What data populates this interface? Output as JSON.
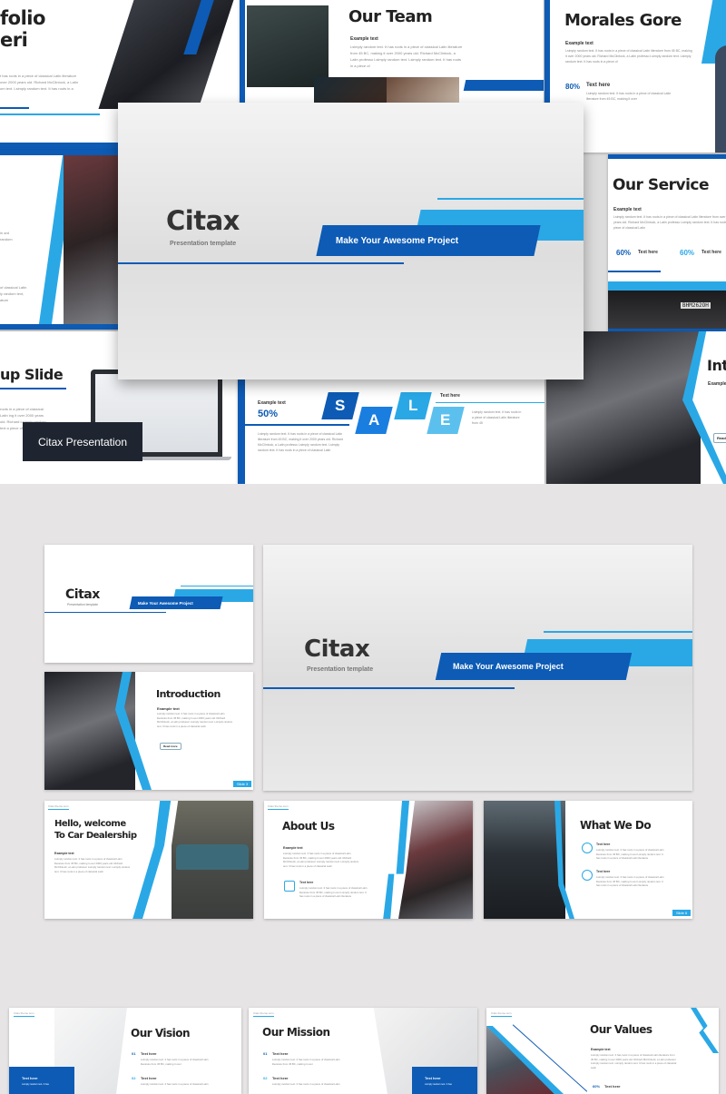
{
  "collage": {
    "portfolio": {
      "title_line1": "folio",
      "title_line2": "eri",
      "body": "t has roots in a piece of classical Latin literature over 2000 years old. Richard McClintock, a Latin om text. Lsimply random text. It has roots in a"
    },
    "team": {
      "title": "Our Team",
      "subtitle": "Example text",
      "body": "Lsimply random text. It has roots in a piece of classical Latin literature from 45 BC, making it over 2000 years old. Richard McClintock, a Latin professo Lsimply random text. Lsimply random text. It has roots in a piece of"
    },
    "morales": {
      "title": "Morales Gore",
      "subtitle": "Example text",
      "body": "Lsimply random text. It has roots in a piece of classical Latin literature from 45 BC, making it over 2000 years old. Richard McClintock, a Latin professo Lsimply random text. Lsimply random text. It has roots in a piece of",
      "stat_value": "80%",
      "stat_label": "Text here",
      "stat_body": "Lsimply random text. It has roots in a piece of classical Latin literature from 45 BC, making it over"
    },
    "service": {
      "title": "Our Service",
      "subtitle": "Example text",
      "body": "Lsimply random text. It has roots in a piece of classical Latin literature from over 2000 years old. Richard McClintock, a Latin professo Lsimply random text. It has roots in a piece of classical Latin",
      "stats": [
        {
          "value": "60%",
          "label": "Text here"
        },
        {
          "value": "60%",
          "label": "Text here"
        }
      ],
      "plate": "BHM262OH"
    },
    "left_mid": {
      "body1": "in ard random",
      "body2": "of classical Latin ly random text, ature"
    },
    "mockup": {
      "title": "up Slide",
      "body": "roots in a piece of classical Latin ing it over 2000 years old. Richard Lsimply random text a piece of classical Latin",
      "caption": "Citax Presentation"
    },
    "sale": {
      "label": "Example text",
      "value": "50%",
      "letters": [
        "S",
        "A",
        "L",
        "E"
      ],
      "text_here": "Text here",
      "body_left": "Lsimply random text. It has roots in a piece of classical Latin literature from 45 BC, making it over 2000 years old. Richard McClintock, a Latin professo Lsimply random text. Lsimply random text. It has roots in a piece of classical Latin",
      "body_right": "Lsimply random text. It has roots in a piece of classical Latin literature from 45"
    },
    "intro_partial": {
      "title": "Int",
      "subtitle": "Example",
      "button": "Read m"
    },
    "hero": {
      "title": "Citax",
      "subtitle": "Presentation template",
      "banner": "Make Your Awesome Project"
    }
  },
  "grid": {
    "cover_small": {
      "title": "Citax",
      "subtitle": "Presentation template",
      "banner": "Make Your Awesome Project"
    },
    "cover_large": {
      "title": "Citax",
      "subtitle": "Presentation template",
      "banner": "Make Your Awesome Project"
    },
    "introduction": {
      "title": "Introduction",
      "subtitle": "Example text",
      "body": "Lsimply random text. It has roots in a piece of classical Latin literature from 45 BC, making it over 2000 years old. Richard McClintock, a Latin professor Lsimply random text. Lsimply random text. It has roots in a piece of classical Latin",
      "button": "Read more",
      "badge": "Slide 3"
    },
    "welcome": {
      "url": "Citax theme.com",
      "title_line1": "Hello, welcome",
      "title_line2": "To Car Dealership",
      "subtitle": "Example text",
      "body": "Lsimply random text. It has roots in a piece of classical Latin literature from 45 BC, making it over 2000 years old. Richard McClintock, a Latin professor Lsimply random text. Lsimply random text. It has roots in a piece of classical Latin"
    },
    "about": {
      "url": "Citax theme.com",
      "title": "About Us",
      "subtitle": "Example text",
      "body": "Lsimply random text. It has roots in a piece of classical Latin literature from 45 BC, making it over 2000 years old. Richard McClintock, a Latin professor Lsimply random text. Lsimply random text. It has roots in a piece of classical Latin",
      "item_title": "Text here",
      "item_body": "Lsimply random text. It has roots in a piece of classical Latin literature from 45 BC, making it over Lsimply random text. It has roots in a piece of classical Latin literature"
    },
    "what_we_do": {
      "title": "What We Do",
      "items": [
        {
          "title": "Text here",
          "body": "Lsimply random text. It has roots in a piece of classical Latin literature from 45 BC, making it over Lsimply random text. It has roots in a piece of classical Latin literature"
        },
        {
          "title": "Text here",
          "body": "Lsimply random text. It has roots in a piece of classical Latin literature from 45 BC, making it over Lsimply random text. It has roots in a piece of classical Latin literature"
        }
      ],
      "badge": "Slide 6"
    },
    "vision": {
      "url": "Citax theme.com",
      "title": "Our Vision",
      "items": [
        {
          "num": "01",
          "title": "Text here",
          "body": "Lsimply random text. It has roots in a piece of classical Latin literature from 45 BC, making it over"
        },
        {
          "num": "02",
          "title": "Text here",
          "body": "Lsimply random text. It has roots in a piece of classical Latin"
        }
      ],
      "card_title": "Text here",
      "card_body": "Lsimply random text. It has"
    },
    "mission": {
      "url": "Citax theme.com",
      "title": "Our Mission",
      "items": [
        {
          "num": "01",
          "title": "Text here",
          "body": "Lsimply random text. It has roots in a piece of classical Latin literature from 45 BC, making it over"
        },
        {
          "num": "02",
          "title": "Text here",
          "body": "Lsimply random text. It has roots in a piece of classical Latin"
        }
      ],
      "card_title": "Text here",
      "card_body": "Lsimply random text. It has"
    },
    "values": {
      "url": "Citax theme.com",
      "title": "Our Values",
      "subtitle": "Example text",
      "body": "Lsimply random text. It has roots in a piece of classical Latin literature from 45 BC, making it over 2000 years old. Richard McClintock, a Latin professor Lsimply random text. Lsimply random text. It has roots in a piece of classical Latin",
      "stat_value": "60%",
      "stat_label": "Text here"
    }
  },
  "colors": {
    "primary": "#0d5bb5",
    "accent": "#2aa8e6",
    "background": "#e6e4e5",
    "caption_bg": "#1e2530"
  }
}
